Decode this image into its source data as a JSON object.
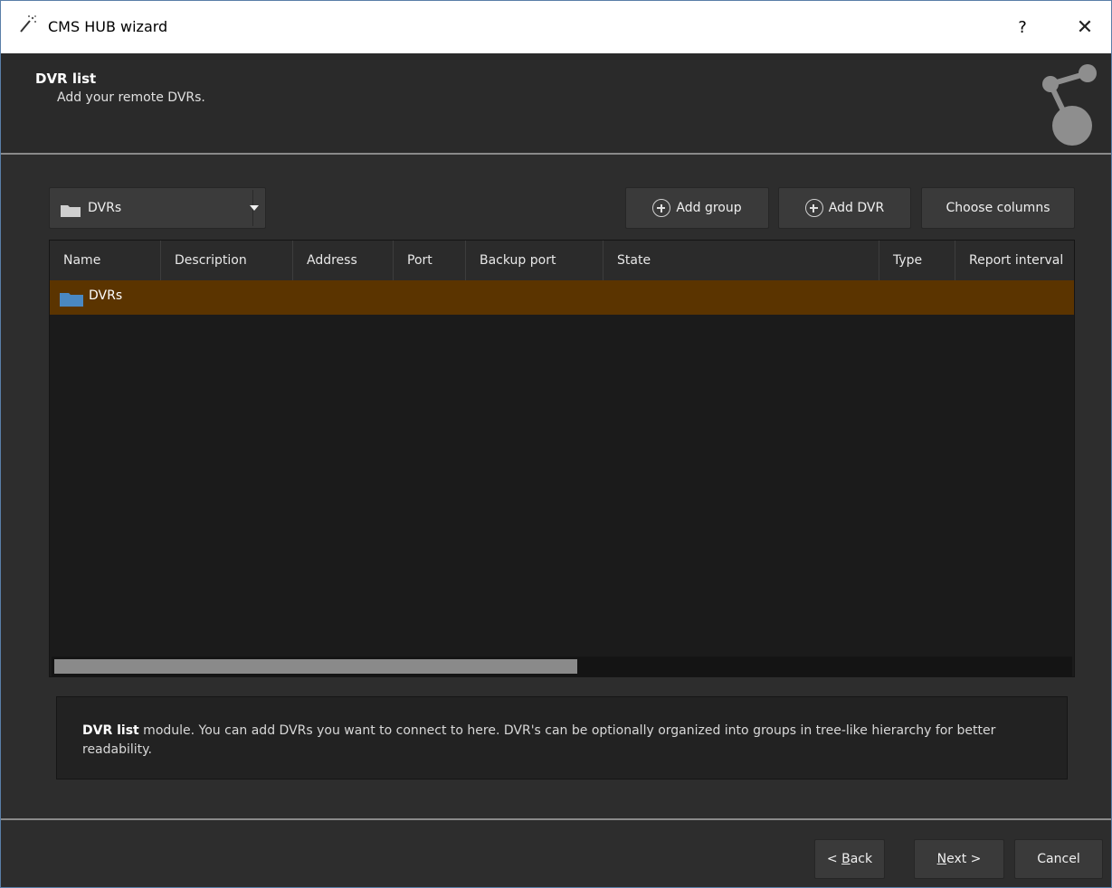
{
  "window": {
    "title": "CMS HUB wizard",
    "help_label": "?",
    "close_label": "✕"
  },
  "header": {
    "title": "DVR list",
    "subtitle": "Add your remote DVRs."
  },
  "group_select": {
    "value": "DVRs"
  },
  "toolbar": {
    "add_group_label": "Add group",
    "add_dvr_label": "Add DVR",
    "choose_columns_label": "Choose columns"
  },
  "table": {
    "columns": [
      "Name",
      "Description",
      "Address",
      "Port",
      "Backup port",
      "State",
      "Type",
      "Report interval"
    ],
    "rows": [
      {
        "name": "DVRs",
        "selected": true
      }
    ],
    "hscroll_position": 0.0,
    "hscroll_visible_fraction": 0.51
  },
  "description": {
    "bold": "DVR list",
    "text": " module. You can add DVRs you want to connect to here. DVR's can be optionally organized into groups in tree-like hierarchy for better readability."
  },
  "footer": {
    "back_prefix": "< ",
    "back_accel": "B",
    "back_rest": "ack",
    "next_accel": "N",
    "next_rest": "ext >",
    "cancel_label": "Cancel"
  },
  "colors": {
    "selection": "#5b3400",
    "folder": "#4a88c2",
    "background": "#2d2d2d"
  }
}
